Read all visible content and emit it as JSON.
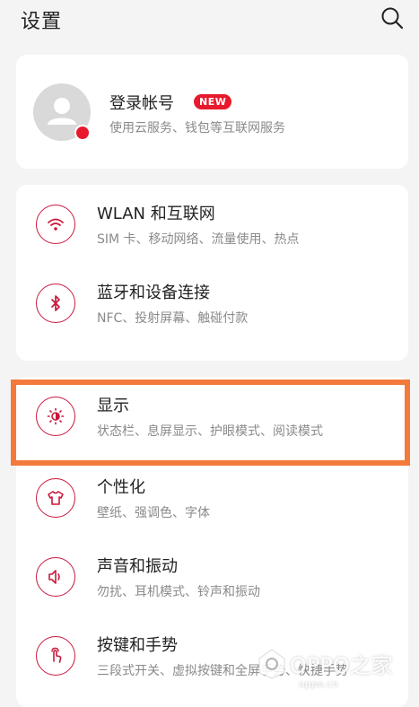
{
  "header": {
    "title": "设置",
    "search_icon": "search-icon"
  },
  "account": {
    "title": "登录帐号",
    "badge": "NEW",
    "subtitle": "使用云服务、钱包等互联网服务",
    "accent": "#e8192c"
  },
  "items": [
    {
      "title": "WLAN 和互联网",
      "subtitle": "SIM 卡、移动网络、流量使用、热点",
      "icon": "wifi-icon"
    },
    {
      "title": "蓝牙和设备连接",
      "subtitle": "NFC、投射屏幕、触碰付款",
      "icon": "bluetooth-icon"
    },
    {
      "title": "显示",
      "subtitle": "状态栏、息屏显示、护眼模式、阅读模式",
      "icon": "brightness-icon"
    },
    {
      "title": "个性化",
      "subtitle": "壁纸、强调色、字体",
      "icon": "tshirt-icon"
    },
    {
      "title": "声音和振动",
      "subtitle": "勿扰、耳机模式、铃声和振动",
      "icon": "speaker-icon"
    },
    {
      "title": "按键和手势",
      "subtitle": "三段式开关、虚拟按键和全屏手势、快捷手势",
      "icon": "gesture-icon"
    }
  ],
  "watermark": {
    "text": "OPPO之家",
    "url": "oppo.cn"
  },
  "colors": {
    "icon_accent": "#c8193c",
    "highlight": "#f37a3b"
  }
}
